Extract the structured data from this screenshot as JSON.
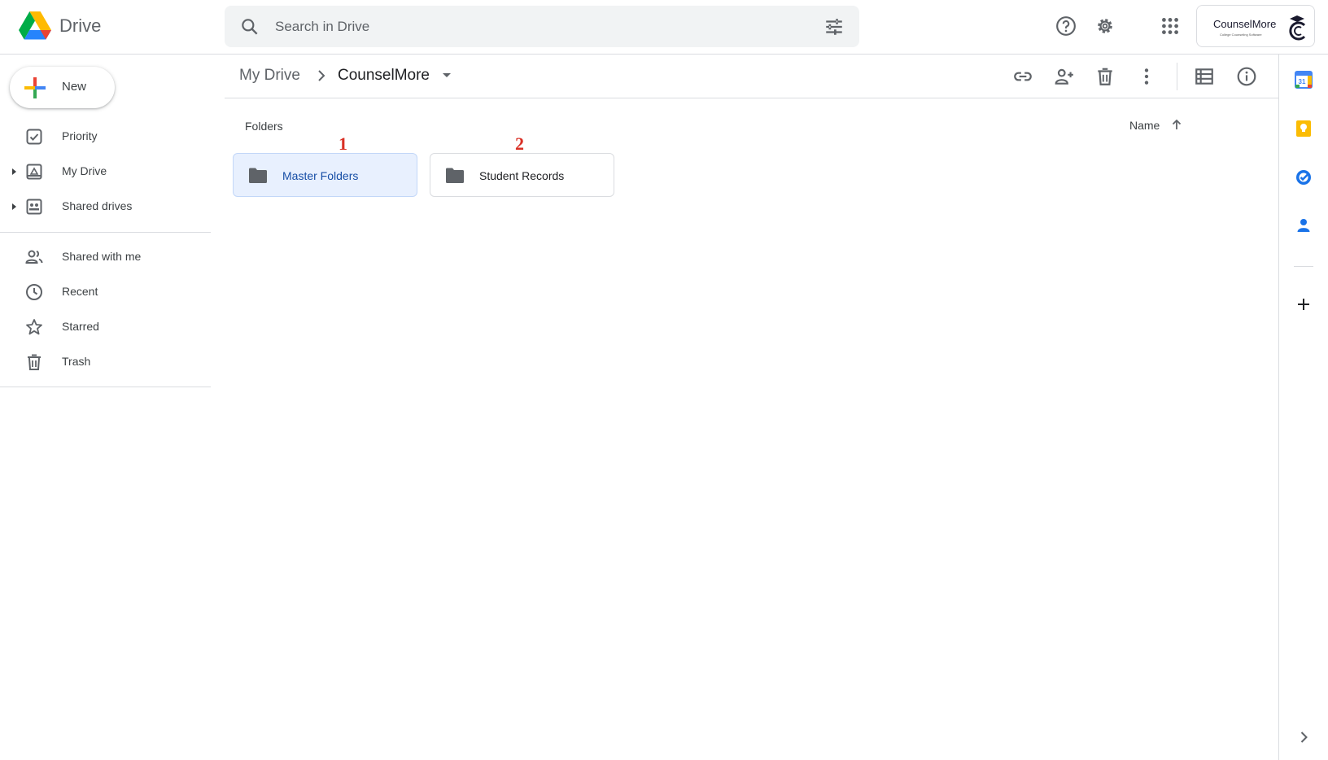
{
  "app": {
    "name": "Drive"
  },
  "search": {
    "placeholder": "Search in Drive"
  },
  "account": {
    "brand": "CounselMore",
    "tagline": "College Counseling Software"
  },
  "sidebar": {
    "new_label": "New",
    "items": [
      {
        "label": "Priority"
      },
      {
        "label": "My Drive"
      },
      {
        "label": "Shared drives"
      },
      {
        "label": "Shared with me"
      },
      {
        "label": "Recent"
      },
      {
        "label": "Starred"
      },
      {
        "label": "Trash"
      }
    ]
  },
  "breadcrumb": {
    "root": "My Drive",
    "current": "CounselMore"
  },
  "main": {
    "section_label": "Folders",
    "sort_label": "Name",
    "folders": [
      {
        "name": "Master Folders",
        "selected": true,
        "annotation": "1"
      },
      {
        "name": "Student Records",
        "selected": false,
        "annotation": "2"
      }
    ]
  },
  "colors": {
    "accent": "#1a73e8",
    "selected_bg": "#e8f0fe",
    "selected_text": "#174ea6",
    "annotation": "#d93025",
    "icon": "#5f6368"
  }
}
